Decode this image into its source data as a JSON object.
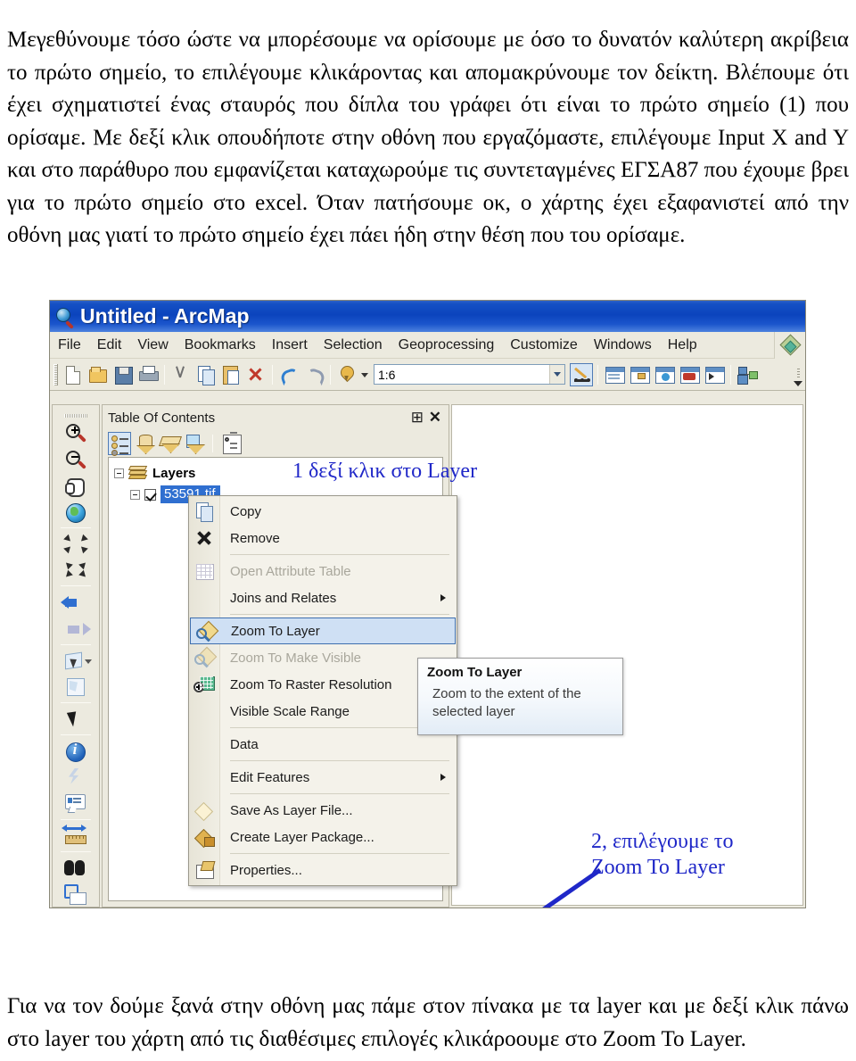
{
  "document": {
    "top_paragraph": "Μεγεθύνουμε τόσο ώστε να μπορέσουμε να ορίσουμε με όσο το δυνατόν καλύτερη ακρίβεια το πρώτο σημείο, το επιλέγουμε κλικάροντας και απομακρύνουμε τον δείκτη. Βλέπουμε ότι έχει σχηματιστεί ένας σταυρός που δίπλα του γράφει ότι είναι το πρώτο σημείο (1) που ορίσαμε. Με δεξί κλικ οπουδήποτε στην οθόνη που εργαζόμαστε, επιλέγουμε Input X and Y και στο παράθυρο που εμφανίζεται καταχωρούμε τις συντεταγμένες ΕΓΣΑ87 που έχουμε βρει για το πρώτο σημείο στο excel. Όταν πατήσουμε οκ, ο χάρτης έχει εξαφανιστεί από την οθόνη μας  γιατί το πρώτο σημείο έχει πάει ήδη στην θέση που του ορίσαμε.",
    "bottom_paragraph": "Για να τον δούμε ξανά στην οθόνη μας πάμε στον πίνακα με τα layer και με δεξί κλικ πάνω στο layer του χάρτη από τις διαθέσιμες επιλογές κλικάροουμε στο Zoom To Layer."
  },
  "arcmap": {
    "title": "Untitled - ArcMap",
    "menu": [
      "File",
      "Edit",
      "View",
      "Bookmarks",
      "Insert",
      "Selection",
      "Geoprocessing",
      "Customize",
      "Windows",
      "Help"
    ],
    "toolbar": {
      "scale_value": "1:6",
      "buttons": [
        {
          "name": "new-map-button",
          "icon": "new-document-icon"
        },
        {
          "name": "open-button",
          "icon": "open-folder-icon"
        },
        {
          "name": "save-button",
          "icon": "floppy-disk-icon"
        },
        {
          "name": "print-button",
          "icon": "printer-icon"
        },
        {
          "name": "cut-button",
          "icon": "scissors-icon"
        },
        {
          "name": "copy-button",
          "icon": "copy-icon"
        },
        {
          "name": "paste-button",
          "icon": "paste-icon"
        },
        {
          "name": "delete-button",
          "icon": "red-x-icon"
        },
        {
          "name": "undo-button",
          "icon": "undo-arrow-icon"
        },
        {
          "name": "redo-button",
          "icon": "redo-arrow-icon"
        },
        {
          "name": "add-data-button",
          "icon": "add-data-icon"
        }
      ],
      "right_buttons": [
        {
          "name": "editor-toolbar-button",
          "icon": "editor-pencil-icon"
        },
        {
          "name": "table-of-contents-button",
          "icon": "table-of-contents-window-icon"
        },
        {
          "name": "catalog-button",
          "icon": "catalog-window-icon"
        },
        {
          "name": "search-button",
          "icon": "search-window-icon"
        },
        {
          "name": "arctoolbox-button",
          "icon": "arctoolbox-icon"
        },
        {
          "name": "python-window-button",
          "icon": "python-window-icon"
        },
        {
          "name": "modelbuilder-button",
          "icon": "modelbuilder-icon"
        }
      ]
    },
    "tools_toolbar": [
      {
        "name": "zoom-in-tool",
        "icon": "zoom-in-magnifier-icon"
      },
      {
        "name": "zoom-out-tool",
        "icon": "zoom-out-magnifier-icon"
      },
      {
        "name": "pan-tool",
        "icon": "pan-hand-icon"
      },
      {
        "name": "full-extent-tool",
        "icon": "globe-icon"
      },
      {
        "name": "fixed-zoom-in-tool",
        "icon": "fixed-zoom-in-icon"
      },
      {
        "name": "fixed-zoom-out-tool",
        "icon": "fixed-zoom-out-icon"
      },
      {
        "name": "go-back-extent-tool",
        "icon": "back-arrow-icon"
      },
      {
        "name": "go-forward-extent-tool",
        "icon": "forward-arrow-icon"
      },
      {
        "name": "select-features-tool",
        "icon": "select-features-icon"
      },
      {
        "name": "clear-selection-tool",
        "icon": "clear-selection-icon"
      },
      {
        "name": "select-elements-tool",
        "icon": "pointer-arrow-icon"
      },
      {
        "name": "identify-tool",
        "icon": "identify-info-icon"
      },
      {
        "name": "hyperlink-tool",
        "icon": "lightning-hyperlink-icon"
      },
      {
        "name": "html-popup-tool",
        "icon": "html-popup-icon"
      },
      {
        "name": "measure-tool",
        "icon": "measure-ruler-icon"
      },
      {
        "name": "find-tool",
        "icon": "binoculars-icon"
      },
      {
        "name": "go-to-xy-tool",
        "icon": "go-to-xy-icon"
      }
    ],
    "toc": {
      "title": "Table Of Contents",
      "pin_glyph": "⊞",
      "close_glyph": "✕",
      "tabs": [
        {
          "name": "list-by-drawing-order-button",
          "icon": "list-by-drawing-order-icon",
          "selected": true
        },
        {
          "name": "list-by-source-button",
          "icon": "list-by-source-icon",
          "selected": false
        },
        {
          "name": "list-by-visibility-button",
          "icon": "list-by-visibility-icon",
          "selected": false
        },
        {
          "name": "list-by-selection-button",
          "icon": "list-by-selection-icon",
          "selected": false
        },
        {
          "name": "toc-options-button",
          "icon": "options-icon",
          "selected": false
        }
      ],
      "tree": {
        "root_label": "Layers",
        "layer_label": "53591.tif",
        "layer_checked": true
      }
    },
    "context_menu": [
      {
        "label": "Copy",
        "icon": "copy-icon",
        "state": "normal",
        "submenu": false
      },
      {
        "label": "Remove",
        "icon": "remove-x-icon",
        "state": "normal",
        "submenu": false
      },
      {
        "separator_after": true,
        "label": "Open Attribute Table",
        "icon": "attribute-table-icon",
        "state": "disabled",
        "submenu": false
      },
      {
        "label": "Joins and Relates",
        "icon": "none",
        "state": "normal",
        "submenu": true
      },
      {
        "label": "Zoom To Layer",
        "icon": "zoom-to-layer-icon",
        "state": "highlighted",
        "submenu": false
      },
      {
        "label": "Zoom To Make Visible",
        "icon": "zoom-to-make-visible-icon",
        "state": "disabled",
        "submenu": false
      },
      {
        "label": "Zoom To Raster Resolution",
        "icon": "zoom-to-raster-resolution-icon",
        "state": "normal",
        "submenu": false
      },
      {
        "label": "Visible Scale Range",
        "icon": "none",
        "state": "normal",
        "submenu": false
      },
      {
        "label": "Data",
        "icon": "none",
        "state": "normal",
        "submenu": false
      },
      {
        "label": "Edit Features",
        "icon": "none",
        "state": "normal",
        "submenu": true
      },
      {
        "label": "Save As Layer File...",
        "icon": "layer-file-diamond-icon",
        "state": "normal",
        "submenu": false
      },
      {
        "label": "Create Layer Package...",
        "icon": "layer-package-icon",
        "state": "normal",
        "submenu": false
      },
      {
        "label": "Properties...",
        "icon": "properties-icon",
        "state": "normal",
        "submenu": false
      }
    ],
    "tooltip": {
      "title": "Zoom To Layer",
      "body": "Zoom to the extent of the selected layer"
    }
  },
  "annotations": {
    "note_1": "1 δεξί κλικ στο Layer",
    "note_2": "2, επιλέγουμε το\nZoom To Layer",
    "color": "#1f27c8"
  }
}
